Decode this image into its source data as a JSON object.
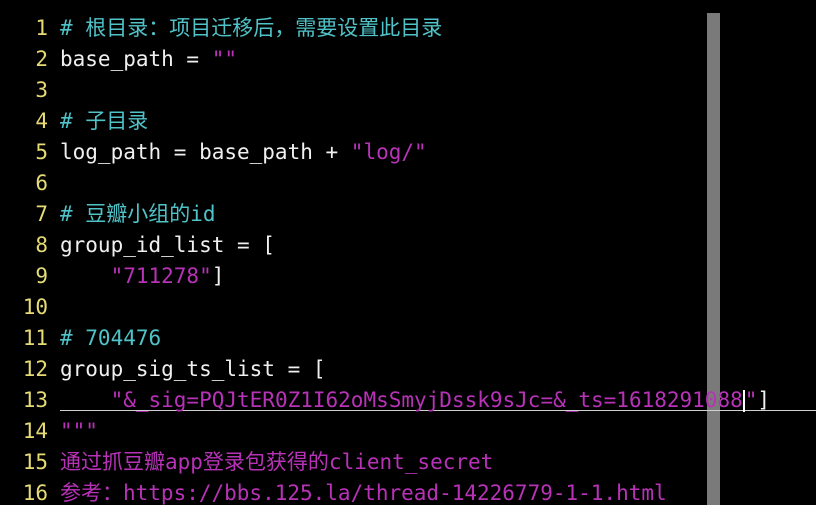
{
  "lines": [
    {
      "n": "1",
      "segments": [
        {
          "t": "# 根目录：项目迁移后，需要设置此目录",
          "c": "comment"
        }
      ]
    },
    {
      "n": "2",
      "segments": [
        {
          "t": "base_path = ",
          "c": "code"
        },
        {
          "t": "\"\"",
          "c": "string"
        }
      ]
    },
    {
      "n": "3",
      "segments": []
    },
    {
      "n": "4",
      "segments": [
        {
          "t": "# 子目录",
          "c": "comment"
        }
      ]
    },
    {
      "n": "5",
      "segments": [
        {
          "t": "log_path = base_path + ",
          "c": "code"
        },
        {
          "t": "\"log/\"",
          "c": "string"
        }
      ]
    },
    {
      "n": "6",
      "segments": []
    },
    {
      "n": "7",
      "segments": [
        {
          "t": "# 豆瓣小组的id",
          "c": "comment"
        }
      ]
    },
    {
      "n": "8",
      "segments": [
        {
          "t": "group_id_list = [",
          "c": "code"
        }
      ]
    },
    {
      "n": "9",
      "segments": [
        {
          "t": "    ",
          "c": "code"
        },
        {
          "t": "\"711278\"",
          "c": "string"
        },
        {
          "t": "]",
          "c": "code"
        }
      ]
    },
    {
      "n": "10",
      "segments": []
    },
    {
      "n": "11",
      "segments": [
        {
          "t": "# 704476",
          "c": "comment"
        }
      ]
    },
    {
      "n": "12",
      "segments": [
        {
          "t": "group_sig_ts_list = [",
          "c": "code"
        }
      ]
    },
    {
      "n": "13",
      "segments": [
        {
          "t": "    ",
          "c": "code"
        },
        {
          "t": "\"&_sig=PQJtER0Z1I62oMsSmyjDssk9sJc=&_ts=1618291088",
          "c": "string"
        },
        {
          "t": "\"",
          "c": "string"
        },
        {
          "t": "]",
          "c": "code"
        }
      ]
    },
    {
      "n": "14",
      "segments": [
        {
          "t": "\"\"\"",
          "c": "docstring"
        }
      ]
    },
    {
      "n": "15",
      "segments": [
        {
          "t": "通过抓豆瓣app登录包获得的client_secret",
          "c": "docstring"
        }
      ]
    },
    {
      "n": "16",
      "segments": [
        {
          "t": "参考：https://bbs.125.la/thread-14226779-1-1.html",
          "c": "docstring"
        }
      ]
    }
  ],
  "colors": {
    "background": "#000000",
    "line_number": "#e6db74",
    "code": "#f0f0f0",
    "comment": "#4fc3c8",
    "string": "#b832b8",
    "colorcolumn": "#7a7a7a"
  }
}
